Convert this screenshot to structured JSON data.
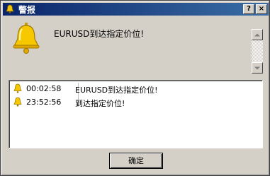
{
  "window": {
    "title": "警报",
    "title_icon": "bell-icon",
    "help_label": "?",
    "close_label": "×"
  },
  "alert": {
    "icon": "bell-icon",
    "message": "EURUSD到达指定价位!"
  },
  "list": {
    "rows": [
      {
        "time": "00:02:58",
        "message": "EURUSD到达指定价位!"
      },
      {
        "time": "23:52:56",
        "message": "到达指定价位!"
      }
    ]
  },
  "buttons": {
    "ok_label": "确定"
  },
  "colors": {
    "titlebar_start": "#0a246a",
    "titlebar_end": "#3a6ea5",
    "face": "#d4d0c8",
    "bell": "#f5c400"
  }
}
